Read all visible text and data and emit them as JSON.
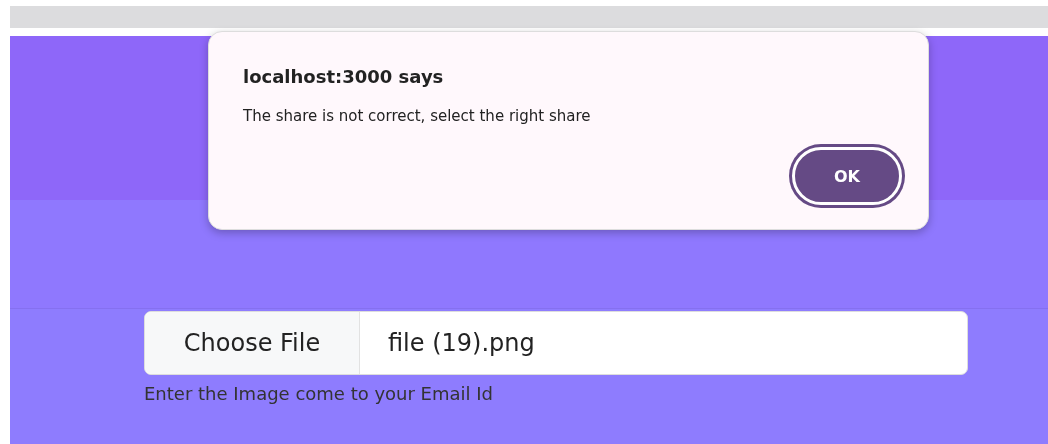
{
  "dialog": {
    "title": "localhost:3000 says",
    "message": "The share is not correct, select the right share",
    "button": "OK"
  },
  "file_input": {
    "button": "Choose File",
    "value": "file (19).png"
  },
  "hint": "Enter the Image come to your Email Id"
}
